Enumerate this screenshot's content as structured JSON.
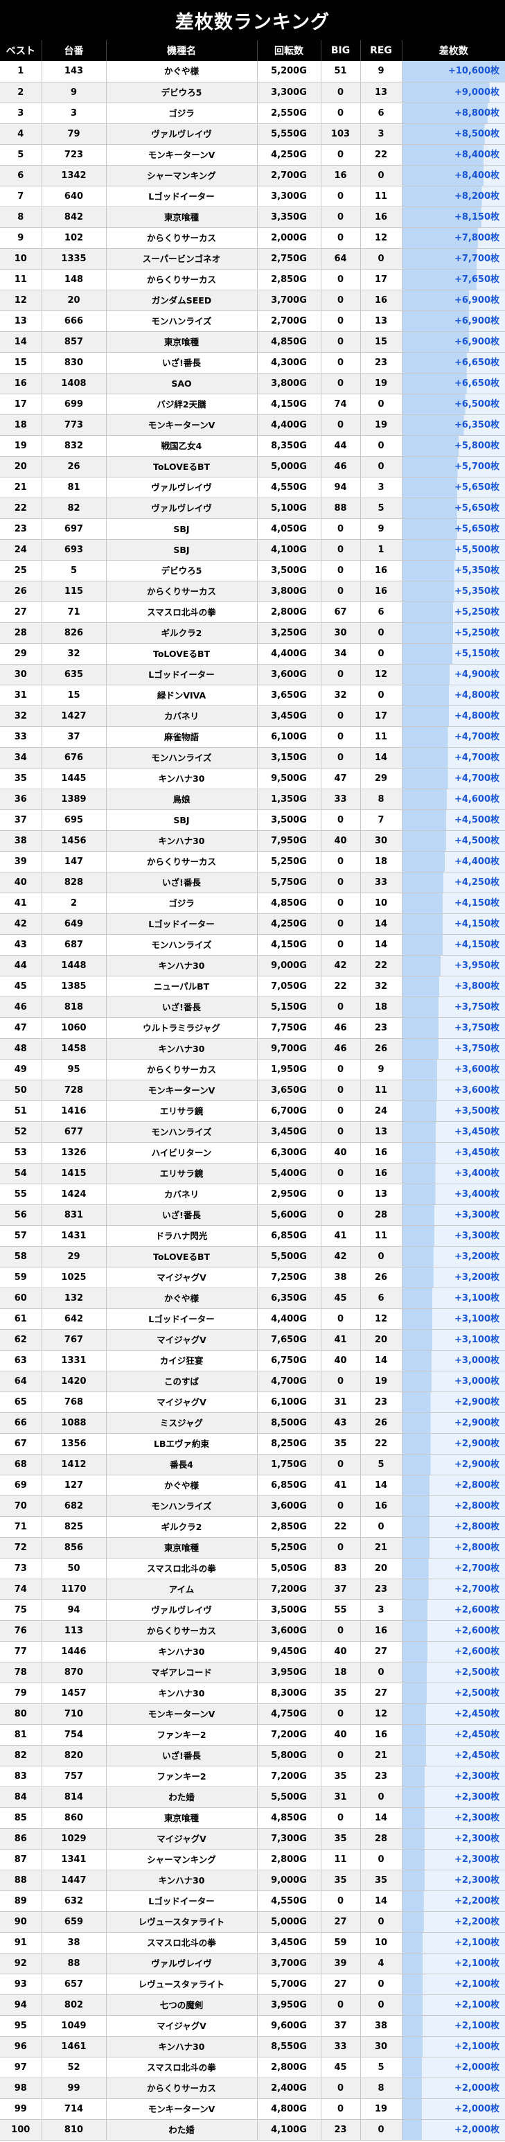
{
  "title": "差枚数ランキング",
  "colors": {
    "header_bg": "#000000",
    "diff_text": "#1a55d8",
    "diff_bar": "#bcd8f6"
  },
  "columns": [
    "ベスト",
    "台番",
    "機種名",
    "回転数",
    "BIG",
    "REG",
    "差枚数"
  ],
  "rows": [
    {
      "rank": "1",
      "machine_no": "143",
      "name": "かぐや様",
      "spins": "5,200G",
      "big": "51",
      "reg": "9",
      "diff": "+10,600枚",
      "diff_value": 10600
    },
    {
      "rank": "2",
      "machine_no": "9",
      "name": "デビウろ5",
      "spins": "3,300G",
      "big": "0",
      "reg": "13",
      "diff": "+9,000枚",
      "diff_value": 9000
    },
    {
      "rank": "3",
      "machine_no": "3",
      "name": "ゴジラ",
      "spins": "2,550G",
      "big": "0",
      "reg": "6",
      "diff": "+8,800枚",
      "diff_value": 8800
    },
    {
      "rank": "4",
      "machine_no": "79",
      "name": "ヴァルヴレイヴ",
      "spins": "5,550G",
      "big": "103",
      "reg": "3",
      "diff": "+8,500枚",
      "diff_value": 8500
    },
    {
      "rank": "5",
      "machine_no": "723",
      "name": "モンキーターンV",
      "spins": "4,250G",
      "big": "0",
      "reg": "22",
      "diff": "+8,400枚",
      "diff_value": 8400
    },
    {
      "rank": "6",
      "machine_no": "1342",
      "name": "シャーマンキング",
      "spins": "2,700G",
      "big": "16",
      "reg": "0",
      "diff": "+8,400枚",
      "diff_value": 8400
    },
    {
      "rank": "7",
      "machine_no": "640",
      "name": "Lゴッドイーター",
      "spins": "3,300G",
      "big": "0",
      "reg": "11",
      "diff": "+8,200枚",
      "diff_value": 8200
    },
    {
      "rank": "8",
      "machine_no": "842",
      "name": "東京喰種",
      "spins": "3,350G",
      "big": "0",
      "reg": "16",
      "diff": "+8,150枚",
      "diff_value": 8150
    },
    {
      "rank": "9",
      "machine_no": "102",
      "name": "からくりサーカス",
      "spins": "2,000G",
      "big": "0",
      "reg": "12",
      "diff": "+7,800枚",
      "diff_value": 7800
    },
    {
      "rank": "10",
      "machine_no": "1335",
      "name": "スーパービンゴネオ",
      "spins": "2,750G",
      "big": "64",
      "reg": "0",
      "diff": "+7,700枚",
      "diff_value": 7700
    },
    {
      "rank": "11",
      "machine_no": "148",
      "name": "からくりサーカス",
      "spins": "2,850G",
      "big": "0",
      "reg": "17",
      "diff": "+7,650枚",
      "diff_value": 7650
    },
    {
      "rank": "12",
      "machine_no": "20",
      "name": "ガンダムSEED",
      "spins": "3,700G",
      "big": "0",
      "reg": "16",
      "diff": "+6,900枚",
      "diff_value": 6900
    },
    {
      "rank": "13",
      "machine_no": "666",
      "name": "モンハンライズ",
      "spins": "2,700G",
      "big": "0",
      "reg": "13",
      "diff": "+6,900枚",
      "diff_value": 6900
    },
    {
      "rank": "14",
      "machine_no": "857",
      "name": "東京喰種",
      "spins": "4,850G",
      "big": "0",
      "reg": "15",
      "diff": "+6,900枚",
      "diff_value": 6900
    },
    {
      "rank": "15",
      "machine_no": "830",
      "name": "いざ!番長",
      "spins": "4,300G",
      "big": "0",
      "reg": "23",
      "diff": "+6,650枚",
      "diff_value": 6650
    },
    {
      "rank": "16",
      "machine_no": "1408",
      "name": "SAO",
      "spins": "3,800G",
      "big": "0",
      "reg": "19",
      "diff": "+6,650枚",
      "diff_value": 6650
    },
    {
      "rank": "17",
      "machine_no": "699",
      "name": "バジ絆2天膳",
      "spins": "4,150G",
      "big": "74",
      "reg": "0",
      "diff": "+6,500枚",
      "diff_value": 6500
    },
    {
      "rank": "18",
      "machine_no": "773",
      "name": "モンキーターンV",
      "spins": "4,400G",
      "big": "0",
      "reg": "19",
      "diff": "+6,350枚",
      "diff_value": 6350
    },
    {
      "rank": "19",
      "machine_no": "832",
      "name": "戦国乙女4",
      "spins": "8,350G",
      "big": "44",
      "reg": "0",
      "diff": "+5,800枚",
      "diff_value": 5800
    },
    {
      "rank": "20",
      "machine_no": "26",
      "name": "ToLOVEるBT",
      "spins": "5,000G",
      "big": "46",
      "reg": "0",
      "diff": "+5,700枚",
      "diff_value": 5700
    },
    {
      "rank": "21",
      "machine_no": "81",
      "name": "ヴァルヴレイヴ",
      "spins": "4,550G",
      "big": "94",
      "reg": "3",
      "diff": "+5,650枚",
      "diff_value": 5650
    },
    {
      "rank": "22",
      "machine_no": "82",
      "name": "ヴァルヴレイヴ",
      "spins": "5,100G",
      "big": "88",
      "reg": "5",
      "diff": "+5,650枚",
      "diff_value": 5650
    },
    {
      "rank": "23",
      "machine_no": "697",
      "name": "SBJ",
      "spins": "4,050G",
      "big": "0",
      "reg": "9",
      "diff": "+5,650枚",
      "diff_value": 5650
    },
    {
      "rank": "24",
      "machine_no": "693",
      "name": "SBJ",
      "spins": "4,100G",
      "big": "0",
      "reg": "1",
      "diff": "+5,500枚",
      "diff_value": 5500
    },
    {
      "rank": "25",
      "machine_no": "5",
      "name": "デビウろ5",
      "spins": "3,500G",
      "big": "0",
      "reg": "16",
      "diff": "+5,350枚",
      "diff_value": 5350
    },
    {
      "rank": "26",
      "machine_no": "115",
      "name": "からくりサーカス",
      "spins": "3,800G",
      "big": "0",
      "reg": "16",
      "diff": "+5,350枚",
      "diff_value": 5350
    },
    {
      "rank": "27",
      "machine_no": "71",
      "name": "スマスロ北斗の拳",
      "spins": "2,800G",
      "big": "67",
      "reg": "6",
      "diff": "+5,250枚",
      "diff_value": 5250
    },
    {
      "rank": "28",
      "machine_no": "826",
      "name": "ギルクラ2",
      "spins": "3,250G",
      "big": "30",
      "reg": "0",
      "diff": "+5,250枚",
      "diff_value": 5250
    },
    {
      "rank": "29",
      "machine_no": "32",
      "name": "ToLOVEるBT",
      "spins": "4,400G",
      "big": "34",
      "reg": "0",
      "diff": "+5,150枚",
      "diff_value": 5150
    },
    {
      "rank": "30",
      "machine_no": "635",
      "name": "Lゴッドイーター",
      "spins": "3,600G",
      "big": "0",
      "reg": "12",
      "diff": "+4,900枚",
      "diff_value": 4900
    },
    {
      "rank": "31",
      "machine_no": "15",
      "name": "緑ドンVIVA",
      "spins": "3,650G",
      "big": "32",
      "reg": "0",
      "diff": "+4,800枚",
      "diff_value": 4800
    },
    {
      "rank": "32",
      "machine_no": "1427",
      "name": "カバネリ",
      "spins": "3,450G",
      "big": "0",
      "reg": "17",
      "diff": "+4,800枚",
      "diff_value": 4800
    },
    {
      "rank": "33",
      "machine_no": "37",
      "name": "麻雀物語",
      "spins": "6,100G",
      "big": "0",
      "reg": "11",
      "diff": "+4,700枚",
      "diff_value": 4700
    },
    {
      "rank": "34",
      "machine_no": "676",
      "name": "モンハンライズ",
      "spins": "3,150G",
      "big": "0",
      "reg": "14",
      "diff": "+4,700枚",
      "diff_value": 4700
    },
    {
      "rank": "35",
      "machine_no": "1445",
      "name": "キンハナ30",
      "spins": "9,500G",
      "big": "47",
      "reg": "29",
      "diff": "+4,700枚",
      "diff_value": 4700
    },
    {
      "rank": "36",
      "machine_no": "1389",
      "name": "鳥娘",
      "spins": "1,350G",
      "big": "33",
      "reg": "8",
      "diff": "+4,600枚",
      "diff_value": 4600
    },
    {
      "rank": "37",
      "machine_no": "695",
      "name": "SBJ",
      "spins": "3,500G",
      "big": "0",
      "reg": "7",
      "diff": "+4,500枚",
      "diff_value": 4500
    },
    {
      "rank": "38",
      "machine_no": "1456",
      "name": "キンハナ30",
      "spins": "7,950G",
      "big": "40",
      "reg": "30",
      "diff": "+4,500枚",
      "diff_value": 4500
    },
    {
      "rank": "39",
      "machine_no": "147",
      "name": "からくりサーカス",
      "spins": "5,250G",
      "big": "0",
      "reg": "18",
      "diff": "+4,400枚",
      "diff_value": 4400
    },
    {
      "rank": "40",
      "machine_no": "828",
      "name": "いざ!番長",
      "spins": "5,750G",
      "big": "0",
      "reg": "33",
      "diff": "+4,250枚",
      "diff_value": 4250
    },
    {
      "rank": "41",
      "machine_no": "2",
      "name": "ゴジラ",
      "spins": "4,850G",
      "big": "0",
      "reg": "10",
      "diff": "+4,150枚",
      "diff_value": 4150
    },
    {
      "rank": "42",
      "machine_no": "649",
      "name": "Lゴッドイーター",
      "spins": "4,250G",
      "big": "0",
      "reg": "14",
      "diff": "+4,150枚",
      "diff_value": 4150
    },
    {
      "rank": "43",
      "machine_no": "687",
      "name": "モンハンライズ",
      "spins": "4,150G",
      "big": "0",
      "reg": "14",
      "diff": "+4,150枚",
      "diff_value": 4150
    },
    {
      "rank": "44",
      "machine_no": "1448",
      "name": "キンハナ30",
      "spins": "9,000G",
      "big": "42",
      "reg": "22",
      "diff": "+3,950枚",
      "diff_value": 3950
    },
    {
      "rank": "45",
      "machine_no": "1385",
      "name": "ニューパルBT",
      "spins": "7,050G",
      "big": "22",
      "reg": "32",
      "diff": "+3,800枚",
      "diff_value": 3800
    },
    {
      "rank": "46",
      "machine_no": "818",
      "name": "いざ!番長",
      "spins": "5,150G",
      "big": "0",
      "reg": "18",
      "diff": "+3,750枚",
      "diff_value": 3750
    },
    {
      "rank": "47",
      "machine_no": "1060",
      "name": "ウルトラミラジャグ",
      "spins": "7,750G",
      "big": "46",
      "reg": "23",
      "diff": "+3,750枚",
      "diff_value": 3750
    },
    {
      "rank": "48",
      "machine_no": "1458",
      "name": "キンハナ30",
      "spins": "9,700G",
      "big": "46",
      "reg": "26",
      "diff": "+3,750枚",
      "diff_value": 3750
    },
    {
      "rank": "49",
      "machine_no": "95",
      "name": "からくりサーカス",
      "spins": "1,950G",
      "big": "0",
      "reg": "9",
      "diff": "+3,600枚",
      "diff_value": 3600
    },
    {
      "rank": "50",
      "machine_no": "728",
      "name": "モンキーターンV",
      "spins": "3,650G",
      "big": "0",
      "reg": "11",
      "diff": "+3,600枚",
      "diff_value": 3600
    },
    {
      "rank": "51",
      "machine_no": "1416",
      "name": "エリサラ鏡",
      "spins": "6,700G",
      "big": "0",
      "reg": "24",
      "diff": "+3,500枚",
      "diff_value": 3500
    },
    {
      "rank": "52",
      "machine_no": "677",
      "name": "モンハンライズ",
      "spins": "3,450G",
      "big": "0",
      "reg": "13",
      "diff": "+3,450枚",
      "diff_value": 3450
    },
    {
      "rank": "53",
      "machine_no": "1326",
      "name": "ハイビリターン",
      "spins": "6,300G",
      "big": "40",
      "reg": "16",
      "diff": "+3,450枚",
      "diff_value": 3450
    },
    {
      "rank": "54",
      "machine_no": "1415",
      "name": "エリサラ鏡",
      "spins": "5,400G",
      "big": "0",
      "reg": "16",
      "diff": "+3,400枚",
      "diff_value": 3400
    },
    {
      "rank": "55",
      "machine_no": "1424",
      "name": "カバネリ",
      "spins": "2,950G",
      "big": "0",
      "reg": "13",
      "diff": "+3,400枚",
      "diff_value": 3400
    },
    {
      "rank": "56",
      "machine_no": "831",
      "name": "いざ!番長",
      "spins": "5,600G",
      "big": "0",
      "reg": "28",
      "diff": "+3,300枚",
      "diff_value": 3300
    },
    {
      "rank": "57",
      "machine_no": "1431",
      "name": "ドラハナ閃光",
      "spins": "6,850G",
      "big": "41",
      "reg": "11",
      "diff": "+3,300枚",
      "diff_value": 3300
    },
    {
      "rank": "58",
      "machine_no": "29",
      "name": "ToLOVEるBT",
      "spins": "5,500G",
      "big": "42",
      "reg": "0",
      "diff": "+3,200枚",
      "diff_value": 3200
    },
    {
      "rank": "59",
      "machine_no": "1025",
      "name": "マイジャグV",
      "spins": "7,250G",
      "big": "38",
      "reg": "26",
      "diff": "+3,200枚",
      "diff_value": 3200
    },
    {
      "rank": "60",
      "machine_no": "132",
      "name": "かぐや様",
      "spins": "6,350G",
      "big": "45",
      "reg": "6",
      "diff": "+3,100枚",
      "diff_value": 3100
    },
    {
      "rank": "61",
      "machine_no": "642",
      "name": "Lゴッドイーター",
      "spins": "4,400G",
      "big": "0",
      "reg": "12",
      "diff": "+3,100枚",
      "diff_value": 3100
    },
    {
      "rank": "62",
      "machine_no": "767",
      "name": "マイジャグV",
      "spins": "7,650G",
      "big": "41",
      "reg": "20",
      "diff": "+3,100枚",
      "diff_value": 3100
    },
    {
      "rank": "63",
      "machine_no": "1331",
      "name": "カイジ狂宴",
      "spins": "6,750G",
      "big": "40",
      "reg": "14",
      "diff": "+3,000枚",
      "diff_value": 3000
    },
    {
      "rank": "64",
      "machine_no": "1420",
      "name": "このすば",
      "spins": "4,700G",
      "big": "0",
      "reg": "19",
      "diff": "+3,000枚",
      "diff_value": 3000
    },
    {
      "rank": "65",
      "machine_no": "768",
      "name": "マイジャグV",
      "spins": "6,100G",
      "big": "31",
      "reg": "23",
      "diff": "+2,900枚",
      "diff_value": 2900
    },
    {
      "rank": "66",
      "machine_no": "1088",
      "name": "ミスジャグ",
      "spins": "8,500G",
      "big": "43",
      "reg": "26",
      "diff": "+2,900枚",
      "diff_value": 2900
    },
    {
      "rank": "67",
      "machine_no": "1356",
      "name": "LBエヴァ約束",
      "spins": "8,250G",
      "big": "35",
      "reg": "22",
      "diff": "+2,900枚",
      "diff_value": 2900
    },
    {
      "rank": "68",
      "machine_no": "1412",
      "name": "番長4",
      "spins": "1,750G",
      "big": "0",
      "reg": "5",
      "diff": "+2,900枚",
      "diff_value": 2900
    },
    {
      "rank": "69",
      "machine_no": "127",
      "name": "かぐや様",
      "spins": "6,850G",
      "big": "41",
      "reg": "14",
      "diff": "+2,800枚",
      "diff_value": 2800
    },
    {
      "rank": "70",
      "machine_no": "682",
      "name": "モンハンライズ",
      "spins": "3,600G",
      "big": "0",
      "reg": "16",
      "diff": "+2,800枚",
      "diff_value": 2800
    },
    {
      "rank": "71",
      "machine_no": "825",
      "name": "ギルクラ2",
      "spins": "2,850G",
      "big": "22",
      "reg": "0",
      "diff": "+2,800枚",
      "diff_value": 2800
    },
    {
      "rank": "72",
      "machine_no": "856",
      "name": "東京喰種",
      "spins": "5,250G",
      "big": "0",
      "reg": "21",
      "diff": "+2,800枚",
      "diff_value": 2800
    },
    {
      "rank": "73",
      "machine_no": "50",
      "name": "スマスロ北斗の拳",
      "spins": "5,050G",
      "big": "83",
      "reg": "20",
      "diff": "+2,700枚",
      "diff_value": 2700
    },
    {
      "rank": "74",
      "machine_no": "1170",
      "name": "アイム",
      "spins": "7,200G",
      "big": "37",
      "reg": "23",
      "diff": "+2,700枚",
      "diff_value": 2700
    },
    {
      "rank": "75",
      "machine_no": "94",
      "name": "ヴァルヴレイヴ",
      "spins": "3,500G",
      "big": "55",
      "reg": "3",
      "diff": "+2,600枚",
      "diff_value": 2600
    },
    {
      "rank": "76",
      "machine_no": "113",
      "name": "からくりサーカス",
      "spins": "3,600G",
      "big": "0",
      "reg": "16",
      "diff": "+2,600枚",
      "diff_value": 2600
    },
    {
      "rank": "77",
      "machine_no": "1446",
      "name": "キンハナ30",
      "spins": "9,450G",
      "big": "40",
      "reg": "27",
      "diff": "+2,600枚",
      "diff_value": 2600
    },
    {
      "rank": "78",
      "machine_no": "870",
      "name": "マギアレコード",
      "spins": "3,950G",
      "big": "18",
      "reg": "0",
      "diff": "+2,500枚",
      "diff_value": 2500
    },
    {
      "rank": "79",
      "machine_no": "1457",
      "name": "キンハナ30",
      "spins": "8,300G",
      "big": "35",
      "reg": "27",
      "diff": "+2,500枚",
      "diff_value": 2500
    },
    {
      "rank": "80",
      "machine_no": "710",
      "name": "モンキーターンV",
      "spins": "4,750G",
      "big": "0",
      "reg": "12",
      "diff": "+2,450枚",
      "diff_value": 2450
    },
    {
      "rank": "81",
      "machine_no": "754",
      "name": "ファンキー2",
      "spins": "7,200G",
      "big": "40",
      "reg": "16",
      "diff": "+2,450枚",
      "diff_value": 2450
    },
    {
      "rank": "82",
      "machine_no": "820",
      "name": "いざ!番長",
      "spins": "5,800G",
      "big": "0",
      "reg": "21",
      "diff": "+2,450枚",
      "diff_value": 2450
    },
    {
      "rank": "83",
      "machine_no": "757",
      "name": "ファンキー2",
      "spins": "7,200G",
      "big": "35",
      "reg": "23",
      "diff": "+2,300枚",
      "diff_value": 2300
    },
    {
      "rank": "84",
      "machine_no": "814",
      "name": "わた婚",
      "spins": "5,500G",
      "big": "31",
      "reg": "0",
      "diff": "+2,300枚",
      "diff_value": 2300
    },
    {
      "rank": "85",
      "machine_no": "860",
      "name": "東京喰種",
      "spins": "4,850G",
      "big": "0",
      "reg": "14",
      "diff": "+2,300枚",
      "diff_value": 2300
    },
    {
      "rank": "86",
      "machine_no": "1029",
      "name": "マイジャグV",
      "spins": "7,300G",
      "big": "35",
      "reg": "28",
      "diff": "+2,300枚",
      "diff_value": 2300
    },
    {
      "rank": "87",
      "machine_no": "1341",
      "name": "シャーマンキング",
      "spins": "2,800G",
      "big": "11",
      "reg": "0",
      "diff": "+2,300枚",
      "diff_value": 2300
    },
    {
      "rank": "88",
      "machine_no": "1447",
      "name": "キンハナ30",
      "spins": "9,000G",
      "big": "35",
      "reg": "35",
      "diff": "+2,300枚",
      "diff_value": 2300
    },
    {
      "rank": "89",
      "machine_no": "632",
      "name": "Lゴッドイーター",
      "spins": "4,550G",
      "big": "0",
      "reg": "14",
      "diff": "+2,200枚",
      "diff_value": 2200
    },
    {
      "rank": "90",
      "machine_no": "659",
      "name": "レヴュースタァライト",
      "spins": "5,000G",
      "big": "27",
      "reg": "0",
      "diff": "+2,200枚",
      "diff_value": 2200
    },
    {
      "rank": "91",
      "machine_no": "38",
      "name": "スマスロ北斗の拳",
      "spins": "3,450G",
      "big": "59",
      "reg": "10",
      "diff": "+2,100枚",
      "diff_value": 2100
    },
    {
      "rank": "92",
      "machine_no": "88",
      "name": "ヴァルヴレイヴ",
      "spins": "3,700G",
      "big": "39",
      "reg": "4",
      "diff": "+2,100枚",
      "diff_value": 2100
    },
    {
      "rank": "93",
      "machine_no": "657",
      "name": "レヴュースタァライト",
      "spins": "5,700G",
      "big": "27",
      "reg": "0",
      "diff": "+2,100枚",
      "diff_value": 2100
    },
    {
      "rank": "94",
      "machine_no": "802",
      "name": "七つの魔剣",
      "spins": "3,950G",
      "big": "0",
      "reg": "0",
      "diff": "+2,100枚",
      "diff_value": 2100
    },
    {
      "rank": "95",
      "machine_no": "1049",
      "name": "マイジャグV",
      "spins": "9,600G",
      "big": "37",
      "reg": "38",
      "diff": "+2,100枚",
      "diff_value": 2100
    },
    {
      "rank": "96",
      "machine_no": "1461",
      "name": "キンハナ30",
      "spins": "8,550G",
      "big": "33",
      "reg": "30",
      "diff": "+2,100枚",
      "diff_value": 2100
    },
    {
      "rank": "97",
      "machine_no": "52",
      "name": "スマスロ北斗の拳",
      "spins": "2,800G",
      "big": "45",
      "reg": "5",
      "diff": "+2,000枚",
      "diff_value": 2000
    },
    {
      "rank": "98",
      "machine_no": "99",
      "name": "からくりサーカス",
      "spins": "2,400G",
      "big": "0",
      "reg": "8",
      "diff": "+2,000枚",
      "diff_value": 2000
    },
    {
      "rank": "99",
      "machine_no": "714",
      "name": "モンキーターンV",
      "spins": "4,800G",
      "big": "0",
      "reg": "19",
      "diff": "+2,000枚",
      "diff_value": 2000
    },
    {
      "rank": "100",
      "machine_no": "810",
      "name": "わた婚",
      "spins": "4,100G",
      "big": "23",
      "reg": "0",
      "diff": "+2,000枚",
      "diff_value": 2000
    }
  ]
}
